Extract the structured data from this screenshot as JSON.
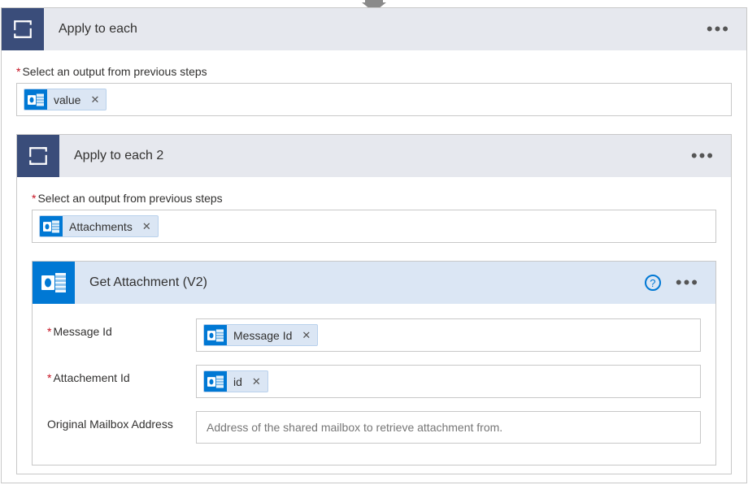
{
  "outer": {
    "title": "Apply to each",
    "output_label": "Select an output from previous steps",
    "token": {
      "label": "value"
    }
  },
  "inner": {
    "title": "Apply to each 2",
    "output_label": "Select an output from previous steps",
    "token": {
      "label": "Attachments"
    }
  },
  "action": {
    "title": "Get Attachment (V2)",
    "fields": {
      "message_id": {
        "label": "Message Id",
        "token_label": "Message Id"
      },
      "attachment_id": {
        "label": "Attachement Id",
        "token_label": "id"
      },
      "mailbox": {
        "label": "Original Mailbox Address",
        "placeholder": "Address of the shared mailbox to retrieve attachment from."
      }
    }
  }
}
